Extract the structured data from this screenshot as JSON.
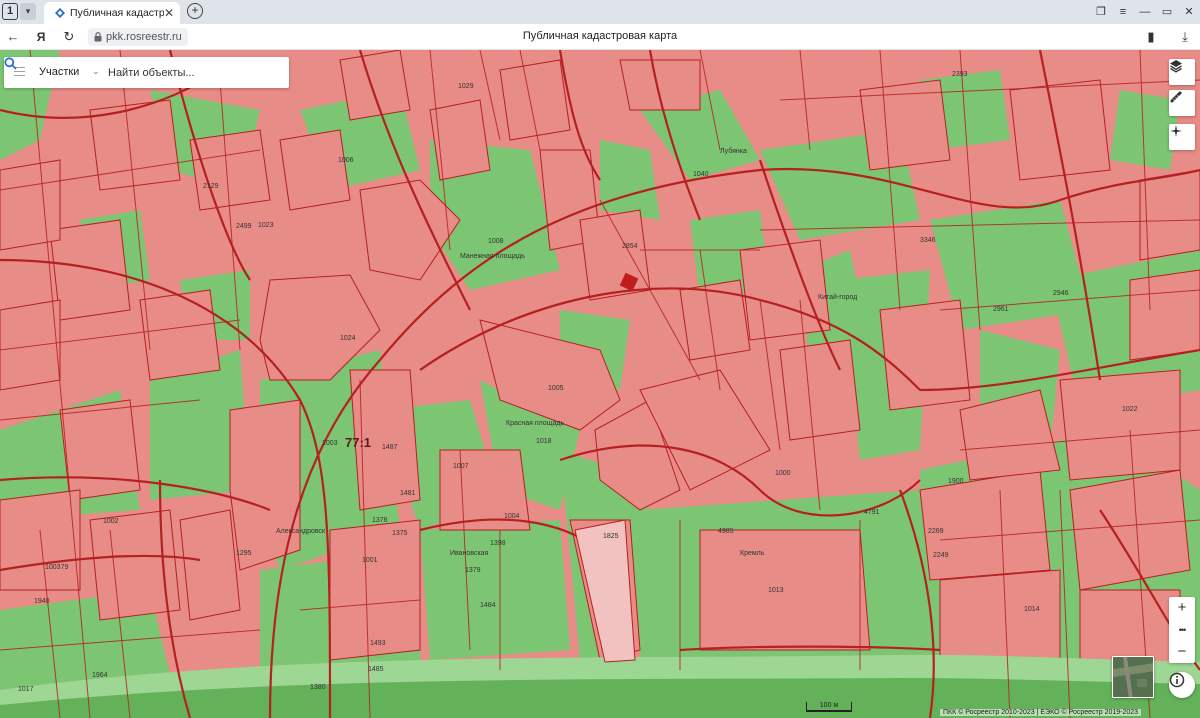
{
  "browser": {
    "tab_count": "1",
    "tab_title": "Публичная кадастрова",
    "tab_close_icon": "close-icon",
    "new_tab_icon": "plus-icon",
    "url": "pkk.rosreestr.ru",
    "page_title": "Публичная кадастровая карта",
    "icons": [
      "back-arrow-icon",
      "yandex-icon",
      "reload-icon",
      "lock-icon",
      "bookmark-icon",
      "download-icon"
    ]
  },
  "search": {
    "mode_label": "Участки",
    "placeholder": "Найти объекты..."
  },
  "map": {
    "region_label": "77:1",
    "labels": [
      "1024",
      "1005",
      "1008",
      "1018",
      "1023",
      "1006",
      "1029",
      "1003",
      "1487",
      "1001",
      "1379",
      "1004",
      "1007",
      "1002",
      "1013",
      "1014",
      "2854",
      "4985",
      "1825",
      "1484",
      "1380",
      "1485",
      "1376",
      "1375",
      "2249",
      "2269",
      "1900",
      "4791",
      "3346",
      "2961",
      "2946",
      "2393",
      "2129",
      "2499",
      "1008",
      "1022",
      "1040",
      "1000",
      "1487",
      "1481",
      "1493",
      "1398",
      "1001",
      "1299",
      "1295",
      "100379",
      "1940",
      "1017",
      "1017",
      "1964"
    ],
    "place_labels": [
      "Александровск",
      "Ивановская",
      "Китай-город",
      "Лубянка",
      "Кремль",
      "Манежная площадь",
      "Красная площадь"
    ],
    "colors": {
      "parcel": "#e88c88",
      "green": "#73c26b",
      "boundary": "#b52020",
      "river": "#a8cfa0"
    }
  },
  "controls": {
    "layers_icon": "layers-icon",
    "ruler_icon": "ruler-icon",
    "locate_icon": "crosshair-icon",
    "zoom_in": "+",
    "zoom_more": "•••",
    "zoom_out": "−",
    "info_icon": "info-icon"
  },
  "footer": {
    "attribution": "ПКК © Росреестр 2010-2023 | ЕЭКО © Росреестр 2019-2023",
    "scale_label": "100 м"
  }
}
